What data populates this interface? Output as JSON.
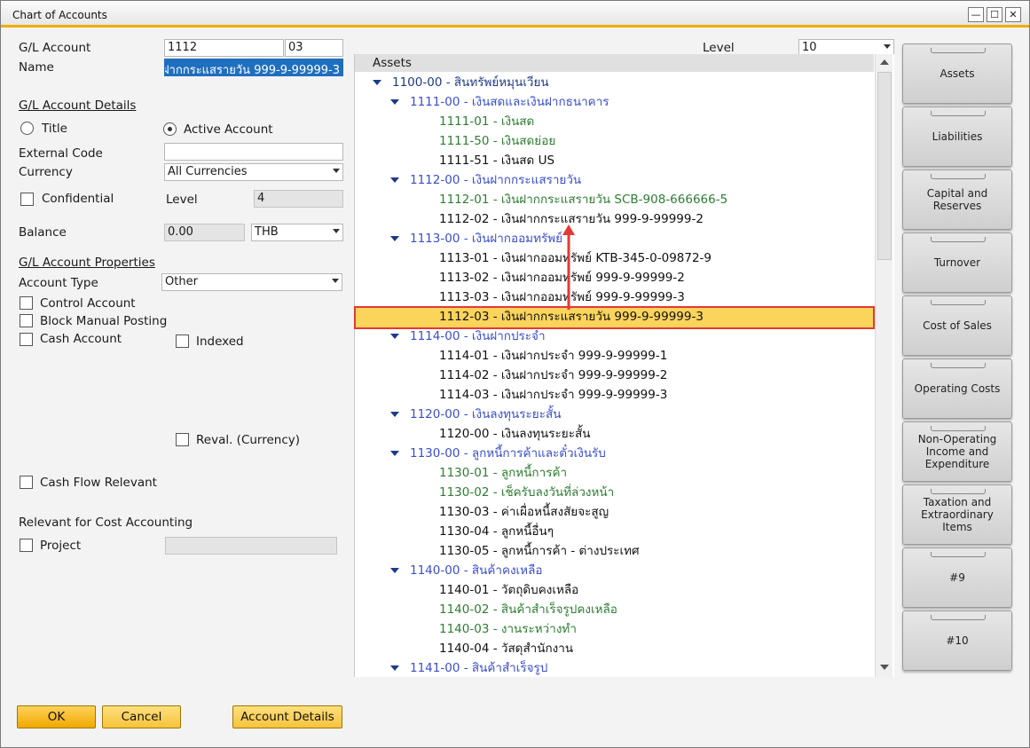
{
  "window": {
    "title": "Chart of Accounts",
    "min": "—",
    "max": "☐",
    "close": "✕"
  },
  "form": {
    "gl_account_label": "G/L Account",
    "gl_account_value": "1112",
    "gl_account_suffix": "03",
    "name_label": "Name",
    "name_value": "ฝากกระแสรายวัน 999-9-99999-3",
    "details_section": "G/L Account Details",
    "title_radio": "Title",
    "active_radio": "Active Account",
    "external_code_label": "External Code",
    "external_code_value": "",
    "currency_label": "Currency",
    "currency_value": "All Currencies",
    "confidential_label": "Confidential",
    "level_label": "Level",
    "level_value": "4",
    "balance_label": "Balance",
    "balance_value": "0.00",
    "balance_currency": "THB",
    "properties_section": "G/L Account Properties",
    "account_type_label": "Account Type",
    "account_type_value": "Other",
    "control_account": "Control Account",
    "block_manual_posting": "Block Manual Posting",
    "cash_account": "Cash Account",
    "indexed": "Indexed",
    "reval_currency": "Reval. (Currency)",
    "cash_flow_relevant": "Cash Flow Relevant",
    "cost_accounting_section": "Relevant for Cost Accounting",
    "project_label": "Project",
    "project_value": ""
  },
  "tree": {
    "level_label": "Level",
    "level_value": "10",
    "header": "Assets",
    "rows": [
      {
        "text": "1100-00 - สินทรัพย์หมุนเวียน",
        "color": "#1e3a8a"
      },
      {
        "text": "1111-00 - เงินสดและเงินฝากธนาคาร",
        "color": "#3a4ecf"
      },
      {
        "text": "1111-01 - เงินสด",
        "color": "#2e7d32"
      },
      {
        "text": "1111-50 - เงินสดย่อย",
        "color": "#2e7d32"
      },
      {
        "text": "1111-51 - เงินสด US",
        "color": "#111111"
      },
      {
        "text": "1112-00 - เงินฝากกระแสรายวัน",
        "color": "#3a4ecf"
      },
      {
        "text": "1112-01 - เงินฝากกระแสรายวัน SCB-908-666666-5",
        "color": "#2e7d32"
      },
      {
        "text": "1112-02 - เงินฝากกระแสรายวัน 999-9-99999-2",
        "color": "#111111"
      },
      {
        "text": "1113-00 - เงินฝากออมทรัพย์",
        "color": "#3a4ecf"
      },
      {
        "text": "1113-01 - เงินฝากออมทรัพย์ KTB-345-0-09872-9",
        "color": "#111111"
      },
      {
        "text": "1113-02 - เงินฝากออมทรัพย์ 999-9-99999-2",
        "color": "#111111"
      },
      {
        "text": "1113-03 - เงินฝากออมทรัพย์ 999-9-99999-3",
        "color": "#111111"
      },
      {
        "text": "1112-03 - เงินฝากกระแสรายวัน 999-9-99999-3",
        "color": "#111111"
      },
      {
        "text": "1114-00 - เงินฝากประจำ",
        "color": "#3a4ecf"
      },
      {
        "text": "1114-01 - เงินฝากประจำ 999-9-99999-1",
        "color": "#111111"
      },
      {
        "text": "1114-02 - เงินฝากประจำ 999-9-99999-2",
        "color": "#111111"
      },
      {
        "text": "1114-03 - เงินฝากประจำ 999-9-99999-3",
        "color": "#111111"
      },
      {
        "text": "1120-00 - เงินลงทุนระยะสั้น",
        "color": "#3a4ecf"
      },
      {
        "text": "1120-00 - เงินลงทุนระยะสั้น",
        "color": "#111111"
      },
      {
        "text": "1130-00 - ลูกหนี้การค้าและตั๋วเงินรับ",
        "color": "#3a4ecf"
      },
      {
        "text": "1130-01 - ลูกหนี้การค้า",
        "color": "#2e7d32"
      },
      {
        "text": "1130-02 - เช็ครับลงวันที่ล่วงหน้า",
        "color": "#2e7d32"
      },
      {
        "text": "1130-03 - ค่าเผื่อหนี้สงสัยจะสูญ",
        "color": "#111111"
      },
      {
        "text": "1130-04 - ลูกหนี้อื่นๆ",
        "color": "#111111"
      },
      {
        "text": "1130-05 - ลูกหนี้การค้า - ต่างประเทศ",
        "color": "#111111"
      },
      {
        "text": "1140-00 - สินค้าคงเหลือ",
        "color": "#3a4ecf"
      },
      {
        "text": "1140-01 - วัตถุดิบคงเหลือ",
        "color": "#111111"
      },
      {
        "text": "1140-02 - สินค้าสำเร็จรูปคงเหลือ",
        "color": "#2e7d32"
      },
      {
        "text": "1140-03 - งานระหว่างทำ",
        "color": "#2e7d32"
      },
      {
        "text": "1140-04 - วัสดุสำนักงาน",
        "color": "#111111"
      },
      {
        "text": "1141-00 - สินค้าสำเร็จรูป",
        "color": "#3a4ecf"
      }
    ]
  },
  "drawers": [
    "Assets",
    "Liabilities",
    "Capital and Reserves",
    "Turnover",
    "Cost of Sales",
    "Operating Costs",
    "Non-Operating Income and Expenditure",
    "Taxation and Extraordinary Items",
    "#9",
    "#10"
  ],
  "buttons": {
    "ok": "OK",
    "cancel": "Cancel",
    "account_details": "Account Details"
  },
  "colors": {
    "accent": "#f0ab00",
    "selection": "#fbd45c",
    "highlight_border": "#e53935"
  }
}
